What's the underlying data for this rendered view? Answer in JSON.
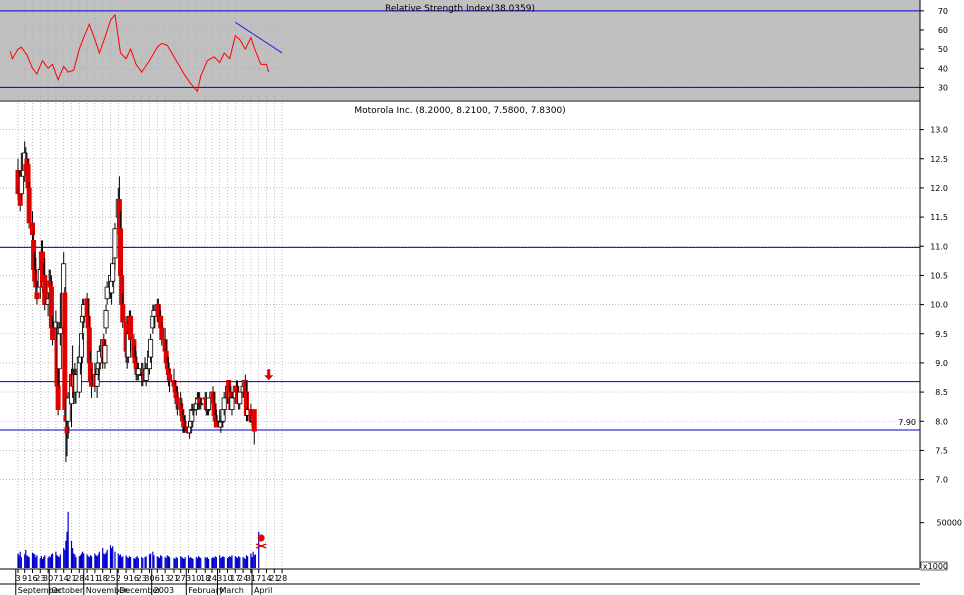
{
  "colors": {
    "rsi_panel_bg": "#c0c0c0",
    "grid": "#9a9a9a",
    "level_line": "#0000cc",
    "up_candle": "#ffffff",
    "down_candle": "#e00000",
    "wick": "#000000",
    "rsi_line": "#ff0000",
    "trend_line": "#2020dd",
    "volume_bar": "#0000cc"
  },
  "chart_data": [
    {
      "type": "line",
      "title": "Relative Strength Index(38.0359)",
      "ylim": [
        25,
        72
      ],
      "y_ticks": [
        30,
        40,
        50,
        60,
        70
      ],
      "grid": true,
      "reference_lines": [
        70,
        30
      ],
      "x_start": "2002-08-26",
      "x": [
        "2002-08-27",
        "2002-08-29",
        "2002-09-03",
        "2002-09-06",
        "2002-09-11",
        "2002-09-16",
        "2002-09-20",
        "2002-09-25",
        "2002-09-30",
        "2002-10-04",
        "2002-10-09",
        "2002-10-14",
        "2002-10-18",
        "2002-10-23",
        "2002-10-28",
        "2002-11-01",
        "2002-11-06",
        "2002-11-11",
        "2002-11-15",
        "2002-11-20",
        "2002-11-25",
        "2002-11-29",
        "2002-12-04",
        "2002-12-09",
        "2002-12-13",
        "2002-12-18",
        "2002-12-23",
        "2002-12-30",
        "2003-01-06",
        "2003-01-10",
        "2003-01-15",
        "2003-01-21",
        "2003-01-27",
        "2003-01-31",
        "2003-02-05",
        "2003-02-11",
        "2003-02-14",
        "2003-02-20",
        "2003-02-26",
        "2003-03-03",
        "2003-03-07",
        "2003-03-12",
        "2003-03-17",
        "2003-03-21",
        "2003-03-26",
        "2003-03-31",
        "2003-04-04",
        "2003-04-09",
        "2003-04-14",
        "2003-04-16"
      ],
      "series": [
        {
          "values": [
            49,
            45,
            50,
            51,
            47,
            40,
            37,
            44,
            40,
            42,
            34,
            41,
            38,
            39,
            50,
            56,
            63,
            55,
            48,
            56,
            65,
            68,
            48,
            45,
            50,
            42,
            38,
            44,
            51,
            53,
            52,
            46,
            40,
            36,
            32,
            28,
            36,
            44,
            46,
            43,
            48,
            45,
            57,
            55,
            50,
            56,
            49,
            42,
            42,
            38
          ]
        }
      ],
      "annotations": [
        {
          "type": "trendline",
          "from": [
            "2003-03-17",
            64
          ],
          "to": [
            "2003-04-28",
            48
          ]
        }
      ]
    },
    {
      "type": "candlestick",
      "title": "Motorola Inc. (8.2000, 8.2100, 7.5800, 7.8300)",
      "ylim": [
        6.65,
        13.25
      ],
      "y_ticks": [
        7.0,
        7.5,
        8.0,
        8.5,
        9.0,
        9.5,
        10.0,
        10.5,
        11.0,
        11.5,
        12.0,
        12.5,
        13.0
      ],
      "grid": true,
      "reference_lines": [
        10.98,
        8.68,
        7.85
      ],
      "price_label": {
        "value": 7.9,
        "text": "7.90"
      },
      "x": [
        "2002-09-03",
        "2002-09-04",
        "2002-09-05",
        "2002-09-06",
        "2002-09-09",
        "2002-09-10",
        "2002-09-11",
        "2002-09-12",
        "2002-09-13",
        "2002-09-16",
        "2002-09-17",
        "2002-09-18",
        "2002-09-19",
        "2002-09-20",
        "2002-09-23",
        "2002-09-24",
        "2002-09-25",
        "2002-09-26",
        "2002-09-27",
        "2002-09-30",
        "2002-10-01",
        "2002-10-02",
        "2002-10-03",
        "2002-10-04",
        "2002-10-07",
        "2002-10-08",
        "2002-10-09",
        "2002-10-10",
        "2002-10-11",
        "2002-10-14",
        "2002-10-15",
        "2002-10-16",
        "2002-10-17",
        "2002-10-18",
        "2002-10-21",
        "2002-10-22",
        "2002-10-23",
        "2002-10-24",
        "2002-10-25",
        "2002-10-28",
        "2002-10-29",
        "2002-10-30",
        "2002-10-31",
        "2002-11-01",
        "2002-11-04",
        "2002-11-05",
        "2002-11-06",
        "2002-11-07",
        "2002-11-08",
        "2002-11-11",
        "2002-11-12",
        "2002-11-13",
        "2002-11-14",
        "2002-11-15",
        "2002-11-18",
        "2002-11-19",
        "2002-11-20",
        "2002-11-21",
        "2002-11-22",
        "2002-11-25",
        "2002-11-26",
        "2002-11-27",
        "2002-11-29",
        "2002-12-02",
        "2002-12-03",
        "2002-12-04",
        "2002-12-05",
        "2002-12-06",
        "2002-12-09",
        "2002-12-10",
        "2002-12-11",
        "2002-12-12",
        "2002-12-13",
        "2002-12-16",
        "2002-12-17",
        "2002-12-18",
        "2002-12-19",
        "2002-12-20",
        "2002-12-23",
        "2002-12-24",
        "2002-12-26",
        "2002-12-27",
        "2002-12-30",
        "2002-12-31",
        "2003-01-02",
        "2003-01-03",
        "2003-01-06",
        "2003-01-07",
        "2003-01-08",
        "2003-01-09",
        "2003-01-10",
        "2003-01-13",
        "2003-01-14",
        "2003-01-15",
        "2003-01-16",
        "2003-01-17",
        "2003-01-21",
        "2003-01-22",
        "2003-01-23",
        "2003-01-24",
        "2003-01-27",
        "2003-01-28",
        "2003-01-29",
        "2003-01-30",
        "2003-01-31",
        "2003-02-03",
        "2003-02-04",
        "2003-02-05",
        "2003-02-06",
        "2003-02-07",
        "2003-02-10",
        "2003-02-11",
        "2003-02-12",
        "2003-02-13",
        "2003-02-14",
        "2003-02-18",
        "2003-02-19",
        "2003-02-20",
        "2003-02-21",
        "2003-02-24",
        "2003-02-25",
        "2003-02-26",
        "2003-02-27",
        "2003-02-28",
        "2003-03-03",
        "2003-03-04",
        "2003-03-05",
        "2003-03-06",
        "2003-03-07",
        "2003-03-10",
        "2003-03-11",
        "2003-03-12",
        "2003-03-13",
        "2003-03-14",
        "2003-03-17",
        "2003-03-18",
        "2003-03-19",
        "2003-03-20",
        "2003-03-21",
        "2003-03-24",
        "2003-03-25",
        "2003-03-26",
        "2003-03-27",
        "2003-03-28",
        "2003-03-31",
        "2003-04-01",
        "2003-04-02",
        "2003-04-03",
        "2003-04-04",
        "2003-04-07",
        "2003-04-08",
        "2003-04-09",
        "2003-04-10",
        "2003-04-11",
        "2003-04-14",
        "2003-04-15",
        "2003-04-16"
      ],
      "open": [
        12.3,
        12.2,
        11.9,
        11.9,
        12.3,
        12.4,
        12.5,
        12.4,
        12.0,
        11.4,
        11.1,
        10.6,
        10.4,
        10.2,
        10.3,
        10.6,
        10.9,
        10.3,
        10.5,
        10.0,
        10.2,
        10.4,
        10.3,
        9.6,
        9.6,
        9.4,
        8.6,
        8.9,
        9.5,
        9.6,
        10.2,
        8.1,
        7.9,
        8.0,
        8.3,
        8.8,
        8.6,
        8.8,
        8.5,
        8.5,
        9.0,
        9.1,
        9.7,
        9.8,
        10.1,
        9.8,
        9.6,
        9.0,
        8.7,
        8.6,
        8.8,
        8.6,
        8.9,
        9.0,
        9.1,
        9.4,
        9.0,
        9.6,
        10.1,
        10.3,
        10.2,
        10.4,
        10.8,
        11.5,
        11.8,
        11.3,
        10.5,
        10.0,
        9.7,
        9.2,
        9.1,
        9.7,
        9.8,
        9.4,
        9.1,
        9.0,
        8.9,
        8.8,
        8.8,
        8.8,
        8.9,
        8.7,
        8.9,
        9.1,
        9.6,
        9.8,
        9.9,
        10.0,
        9.8,
        9.8,
        9.6,
        9.4,
        9.2,
        9.0,
        8.9,
        8.8,
        8.7,
        8.6,
        8.5,
        8.4,
        8.3,
        8.2,
        8.1,
        8.0,
        7.9,
        7.9,
        7.8,
        7.9,
        8.0,
        8.2,
        8.2,
        8.3,
        8.4,
        8.4,
        8.3,
        8.4,
        8.4,
        8.2,
        8.2,
        8.4,
        8.5,
        8.3,
        8.1,
        8.0,
        8.0,
        7.9,
        8.0,
        8.0,
        8.2,
        8.4,
        8.7,
        8.4,
        8.5,
        8.2,
        8.4,
        8.6,
        8.5,
        8.4,
        8.3,
        8.5,
        8.6,
        8.7,
        8.5,
        8.1,
        8.2,
        8.0,
        8.0,
        8.2
      ],
      "high": [
        12.5,
        12.3,
        12.3,
        12.6,
        12.8,
        12.7,
        12.6,
        12.5,
        12.1,
        11.6,
        11.3,
        10.9,
        10.8,
        10.4,
        10.7,
        11.1,
        11.1,
        10.7,
        10.8,
        10.2,
        10.6,
        10.6,
        10.5,
        9.8,
        9.9,
        9.7,
        9.1,
        9.7,
        10.2,
        10.9,
        10.3,
        8.4,
        8.1,
        8.5,
        8.9,
        9.3,
        8.9,
        9.0,
        8.9,
        9.3,
        9.2,
        9.5,
        10.1,
        10.1,
        10.2,
        10.1,
        9.8,
        9.2,
        8.9,
        9.0,
        8.9,
        8.8,
        9.1,
        9.3,
        9.4,
        9.5,
        9.4,
        10.0,
        10.4,
        10.7,
        10.6,
        10.8,
        11.4,
        12.0,
        12.2,
        11.6,
        10.6,
        10.2,
        9.8,
        9.5,
        9.6,
        9.9,
        9.9,
        9.5,
        9.3,
        9.2,
        9.0,
        9.0,
        9.0,
        9.0,
        9.1,
        9.0,
        9.3,
        9.5,
        10.0,
        10.0,
        10.1,
        10.1,
        10.0,
        9.9,
        9.7,
        9.6,
        9.4,
        9.1,
        9.1,
        8.9,
        8.9,
        8.7,
        8.6,
        8.6,
        8.5,
        8.4,
        8.2,
        8.1,
        8.1,
        8.0,
        8.0,
        8.1,
        8.3,
        8.3,
        8.4,
        8.5,
        8.5,
        8.5,
        8.4,
        8.5,
        8.5,
        8.4,
        8.4,
        8.5,
        8.6,
        8.5,
        8.3,
        8.2,
        8.2,
        8.1,
        8.2,
        8.3,
        8.5,
        8.7,
        8.7,
        8.7,
        8.6,
        8.5,
        8.6,
        8.7,
        8.7,
        8.6,
        8.5,
        8.7,
        8.7,
        8.8,
        8.7,
        8.5,
        8.3,
        8.2,
        8.2,
        8.2
      ],
      "low": [
        11.8,
        11.9,
        11.6,
        11.8,
        12.1,
        12.2,
        12.1,
        11.9,
        11.3,
        11.0,
        10.5,
        10.3,
        10.1,
        10.0,
        10.1,
        10.4,
        10.2,
        10.0,
        9.9,
        9.8,
        10.0,
        10.2,
        9.5,
        9.3,
        9.4,
        8.5,
        8.1,
        8.6,
        9.3,
        9.5,
        8.0,
        7.3,
        7.4,
        7.7,
        7.9,
        8.4,
        8.5,
        8.3,
        8.3,
        8.4,
        8.8,
        8.9,
        9.4,
        9.6,
        9.7,
        9.5,
        8.9,
        8.6,
        8.4,
        8.5,
        8.6,
        8.4,
        8.7,
        8.8,
        8.9,
        9.0,
        8.9,
        9.5,
        10.0,
        10.1,
        10.0,
        10.3,
        10.6,
        11.2,
        11.2,
        10.4,
        9.8,
        9.6,
        9.0,
        8.9,
        9.0,
        9.5,
        9.2,
        9.0,
        8.8,
        8.7,
        8.7,
        8.7,
        8.6,
        8.6,
        8.7,
        8.6,
        8.8,
        9.0,
        9.5,
        9.6,
        9.7,
        9.7,
        9.6,
        9.4,
        9.3,
        9.1,
        8.9,
        8.7,
        8.6,
        8.5,
        8.4,
        8.3,
        8.2,
        8.1,
        8.0,
        7.9,
        7.8,
        7.8,
        7.8,
        7.8,
        7.7,
        7.8,
        7.9,
        8.1,
        8.1,
        8.2,
        8.3,
        8.2,
        8.2,
        8.2,
        8.1,
        8.1,
        8.1,
        8.3,
        8.2,
        8.0,
        7.9,
        7.9,
        7.9,
        7.8,
        7.9,
        8.0,
        8.1,
        8.3,
        8.3,
        8.2,
        8.3,
        8.1,
        8.3,
        8.4,
        8.3,
        8.2,
        8.2,
        8.4,
        8.4,
        8.5,
        8.0,
        8.0,
        8.0,
        7.9,
        7.9,
        7.6
      ],
      "close": [
        11.9,
        12.0,
        11.7,
        12.2,
        12.6,
        12.3,
        12.2,
        12.0,
        11.4,
        11.2,
        10.6,
        10.4,
        10.3,
        10.1,
        10.6,
        10.9,
        10.3,
        10.4,
        10.0,
        10.1,
        10.4,
        10.3,
        9.6,
        9.4,
        9.7,
        8.6,
        8.2,
        9.5,
        9.6,
        10.7,
        8.2,
        8.0,
        7.8,
        8.4,
        8.8,
        8.6,
        8.8,
        8.5,
        8.8,
        9.1,
        9.1,
        9.5,
        9.8,
        10.0,
        9.8,
        9.6,
        9.0,
        8.7,
        8.6,
        8.8,
        8.6,
        8.8,
        9.0,
        9.2,
        9.4,
        9.0,
        9.3,
        9.9,
        10.3,
        10.5,
        10.4,
        10.7,
        11.3,
        11.8,
        11.3,
        10.5,
        10.0,
        9.7,
        9.2,
        9.1,
        9.5,
        9.8,
        9.4,
        9.1,
        9.0,
        8.9,
        8.8,
        8.9,
        8.8,
        8.8,
        8.7,
        8.9,
        9.2,
        9.4,
        9.8,
        9.9,
        10.0,
        9.8,
        9.8,
        9.6,
        9.4,
        9.2,
        9.0,
        8.9,
        8.8,
        8.7,
        8.6,
        8.5,
        8.4,
        8.3,
        8.2,
        8.1,
        8.0,
        7.9,
        7.9,
        7.8,
        7.9,
        8.0,
        8.2,
        8.2,
        8.3,
        8.4,
        8.4,
        8.3,
        8.3,
        8.4,
        8.2,
        8.2,
        8.4,
        8.5,
        8.3,
        8.1,
        8.0,
        7.9,
        8.0,
        8.0,
        8.0,
        8.2,
        8.4,
        8.6,
        8.4,
        8.5,
        8.2,
        8.4,
        8.6,
        8.5,
        8.4,
        8.3,
        8.5,
        8.6,
        8.7,
        8.5,
        8.1,
        8.2,
        8.0,
        8.0,
        8.1,
        7.83
      ],
      "annotations": [
        {
          "type": "arrow-down",
          "date": "2003-04-16",
          "value": 8.72,
          "color": "#e00000"
        }
      ]
    },
    {
      "type": "bar",
      "title": "",
      "unit_label": "x1000",
      "y_ticks": [
        50000
      ],
      "ylim": [
        0,
        75000
      ],
      "x_tick_labels": [
        "3",
        "9",
        "16",
        "23",
        "30",
        "7",
        "14",
        "21",
        "28",
        "4",
        "11",
        "18",
        "25",
        "2",
        "9",
        "16",
        "23",
        "30",
        "6",
        "13",
        "21",
        "27",
        "3",
        "10",
        "18",
        "24",
        "3",
        "10",
        "17",
        "24",
        "31",
        "7",
        "14",
        "21",
        "28"
      ],
      "x_tick_dates": [
        "2002-09-03",
        "2002-09-09",
        "2002-09-16",
        "2002-09-23",
        "2002-09-30",
        "2002-10-07",
        "2002-10-14",
        "2002-10-21",
        "2002-10-28",
        "2002-11-04",
        "2002-11-11",
        "2002-11-18",
        "2002-11-25",
        "2002-12-02",
        "2002-12-09",
        "2002-12-16",
        "2002-12-23",
        "2002-12-30",
        "2003-01-06",
        "2003-01-13",
        "2003-01-21",
        "2003-01-27",
        "2003-02-03",
        "2003-02-10",
        "2003-02-18",
        "2003-02-24",
        "2003-03-03",
        "2003-03-10",
        "2003-03-17",
        "2003-03-24",
        "2003-03-31",
        "2003-04-07",
        "2003-04-14",
        "2003-04-21",
        "2003-04-28"
      ],
      "month_labels": [
        "September",
        "October",
        "November",
        "December",
        "2003",
        "February",
        "March",
        "April"
      ],
      "month_dates": [
        "2002-09-01",
        "2002-10-01",
        "2002-11-01",
        "2002-12-01",
        "2003-01-01",
        "2003-02-01",
        "2003-03-01",
        "2003-04-01"
      ],
      "values": [
        16000,
        14000,
        18000,
        12000,
        15000,
        20000,
        14000,
        13000,
        12000,
        17000,
        16000,
        15000,
        12000,
        14000,
        11000,
        13000,
        10000,
        12000,
        14000,
        11000,
        13000,
        12000,
        15000,
        16000,
        18000,
        14000,
        13000,
        12000,
        15000,
        22000,
        20000,
        30000,
        40000,
        62000,
        30000,
        22000,
        16000,
        15000,
        12000,
        13000,
        14000,
        16000,
        18000,
        16000,
        15000,
        13000,
        12000,
        14000,
        13000,
        16000,
        14000,
        13000,
        15000,
        18000,
        22000,
        16000,
        15000,
        17000,
        20000,
        25000,
        22000,
        24000,
        18000,
        16000,
        14000,
        15000,
        12000,
        13000,
        14000,
        12000,
        11000,
        13000,
        12000,
        11000,
        10000,
        12000,
        13000,
        11000,
        12000,
        11000,
        12000,
        13000,
        15000,
        16000,
        18000,
        14000,
        13000,
        12000,
        11000,
        14000,
        13000,
        12000,
        11000,
        14000,
        13000,
        12000,
        11000,
        10000,
        12000,
        11000,
        13000,
        12000,
        11000,
        10000,
        12000,
        14000,
        11000,
        12000,
        11000,
        10000,
        12000,
        11000,
        13000,
        12000,
        11000,
        12000,
        11000,
        12000,
        10000,
        11000,
        12000,
        11000,
        13000,
        12000,
        14000,
        11000,
        12000,
        13000,
        12000,
        11000,
        12000,
        13000,
        12000,
        14000,
        13000,
        12000,
        11000,
        13000,
        12000,
        12000,
        11000,
        10000,
        14000,
        13000,
        16000,
        12000,
        18000,
        14000,
        15000,
        40000
      ]
    }
  ]
}
